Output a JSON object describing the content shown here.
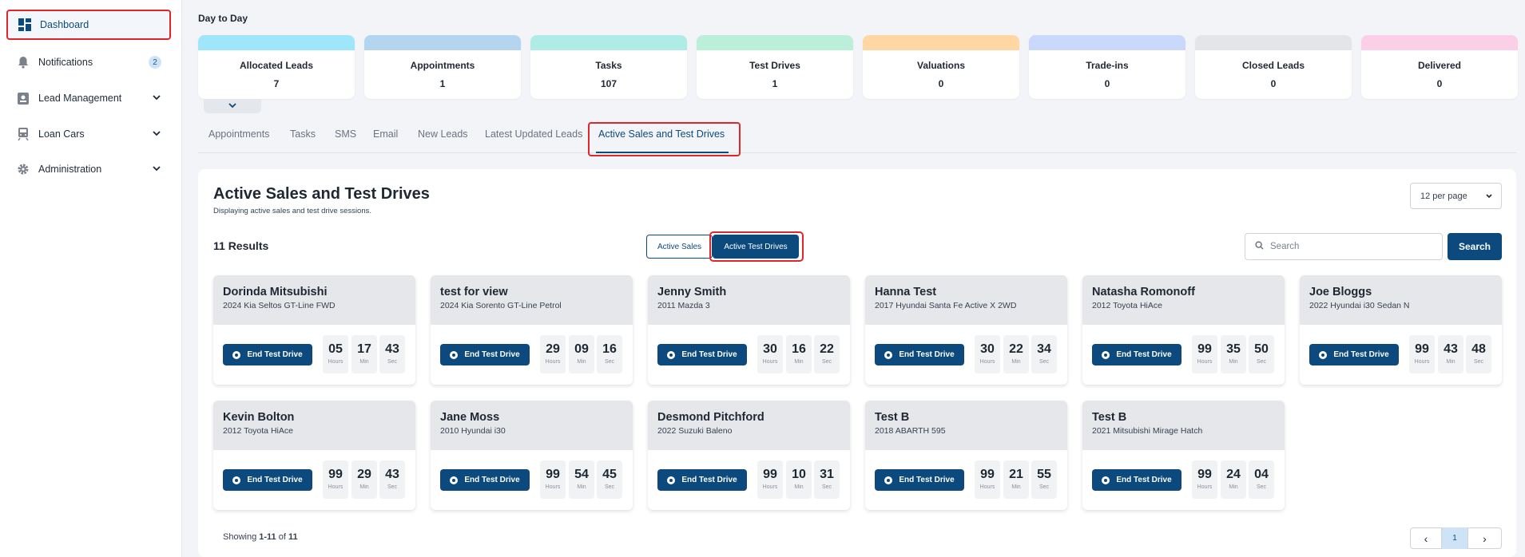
{
  "sidebar": {
    "items": [
      {
        "label": "Dashboard",
        "icon": "dashboard-icon"
      },
      {
        "label": "Notifications",
        "icon": "bell-icon",
        "badge": "2"
      },
      {
        "label": "Lead Management",
        "icon": "badge-icon"
      },
      {
        "label": "Loan Cars",
        "icon": "train-icon"
      },
      {
        "label": "Administration",
        "icon": "gear-icon"
      }
    ]
  },
  "main": {
    "title": "Day to Day",
    "stats": [
      {
        "label": "Allocated Leads",
        "value": "7",
        "color": "#a0e6fb"
      },
      {
        "label": "Appointments",
        "value": "1",
        "color": "#b3d5f0"
      },
      {
        "label": "Tasks",
        "value": "107",
        "color": "#b0ece6"
      },
      {
        "label": "Test Drives",
        "value": "1",
        "color": "#bcefd9"
      },
      {
        "label": "Valuations",
        "value": "0",
        "color": "#ffd7a2"
      },
      {
        "label": "Trade-ins",
        "value": "0",
        "color": "#cad8fb"
      },
      {
        "label": "Closed Leads",
        "value": "0",
        "color": "#e3e5e9"
      },
      {
        "label": "Delivered",
        "value": "0",
        "color": "#fbcfe7"
      }
    ],
    "tabs": [
      "Appointments",
      "Tasks",
      "SMS",
      "Email",
      "New Leads",
      "Latest Updated Leads",
      "Active Sales and Test Drives"
    ],
    "active_tab": "Active Sales and Test Drives"
  },
  "panel": {
    "title": "Active Sales and Test Drives",
    "subtitle": "Displaying active sales and test drive sessions.",
    "per_page": "12 per page",
    "results": "11 Results",
    "segment_sales": "Active Sales",
    "segment_test_drives": "Active Test Drives",
    "search_placeholder": "Search",
    "search_button": "Search",
    "end_label": "End Test Drive",
    "unit_hours": "Hours",
    "unit_min": "Min",
    "unit_sec": "Sec"
  },
  "cards": [
    {
      "name": "Dorinda Mitsubishi",
      "vehicle": "2024 Kia Seltos GT-Line FWD",
      "hours": "05",
      "min": "17",
      "sec": "43"
    },
    {
      "name": "test for view",
      "vehicle": "2024 Kia Sorento GT-Line Petrol",
      "hours": "29",
      "min": "09",
      "sec": "16"
    },
    {
      "name": "Jenny Smith",
      "vehicle": "2011 Mazda 3",
      "hours": "30",
      "min": "16",
      "sec": "22"
    },
    {
      "name": "Hanna Test",
      "vehicle": "2017 Hyundai Santa Fe Active X 2WD",
      "hours": "30",
      "min": "22",
      "sec": "34"
    },
    {
      "name": "Natasha Romonoff",
      "vehicle": "2012 Toyota HiAce",
      "hours": "99",
      "min": "35",
      "sec": "50"
    },
    {
      "name": "Joe Bloggs",
      "vehicle": "2022 Hyundai i30 Sedan N",
      "hours": "99",
      "min": "43",
      "sec": "48"
    },
    {
      "name": "Kevin Bolton",
      "vehicle": "2012 Toyota HiAce",
      "hours": "99",
      "min": "29",
      "sec": "43"
    },
    {
      "name": "Jane Moss",
      "vehicle": "2010 Hyundai i30",
      "hours": "99",
      "min": "54",
      "sec": "45"
    },
    {
      "name": "Desmond Pitchford",
      "vehicle": "2022 Suzuki Baleno",
      "hours": "99",
      "min": "10",
      "sec": "31"
    },
    {
      "name": "Test B",
      "vehicle": "2018 ABARTH 595",
      "hours": "99",
      "min": "21",
      "sec": "55"
    },
    {
      "name": "Test B",
      "vehicle": "2021 Mitsubishi Mirage Hatch",
      "hours": "99",
      "min": "24",
      "sec": "04"
    }
  ],
  "pagination": {
    "showing_prefix": "Showing ",
    "range": "1-11",
    "of": " of ",
    "total": "11",
    "current_page": "1",
    "prev": "‹",
    "next": "›"
  }
}
